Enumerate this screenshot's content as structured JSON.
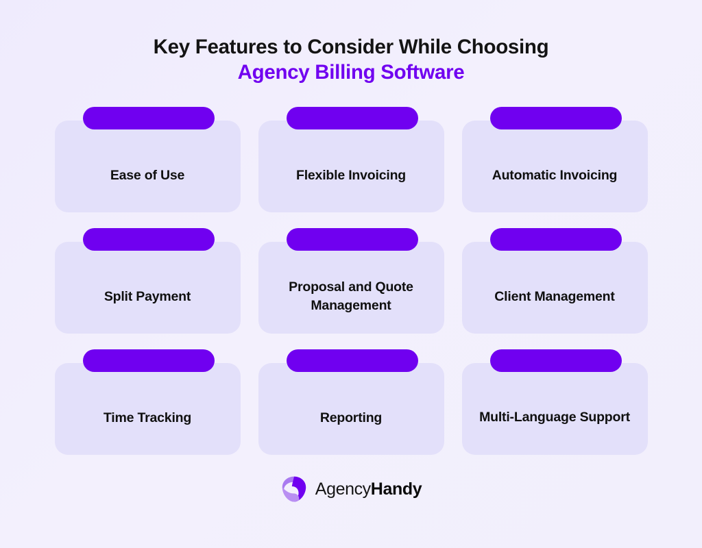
{
  "background": {
    "page_color": "#F2EFFC",
    "card_color": "#E3E0FA",
    "accent_color": "#7000F0"
  },
  "heading": {
    "line1": "Key Features to Consider While Choosing",
    "line2": "Agency Billing Software"
  },
  "cards": [
    {
      "label": "Ease of Use"
    },
    {
      "label": "Flexible Invoicing"
    },
    {
      "label": "Automatic Invoicing"
    },
    {
      "label": "Split Payment"
    },
    {
      "label": "Proposal and Quote Management"
    },
    {
      "label": "Client Management"
    },
    {
      "label": "Time Tracking"
    },
    {
      "label": "Reporting"
    },
    {
      "label": "Multi-Language Support"
    }
  ],
  "logo": {
    "word1": "Agency",
    "word2": "Handy",
    "mark_color_light": "#A97BF0",
    "mark_color_dark": "#7000F0"
  }
}
